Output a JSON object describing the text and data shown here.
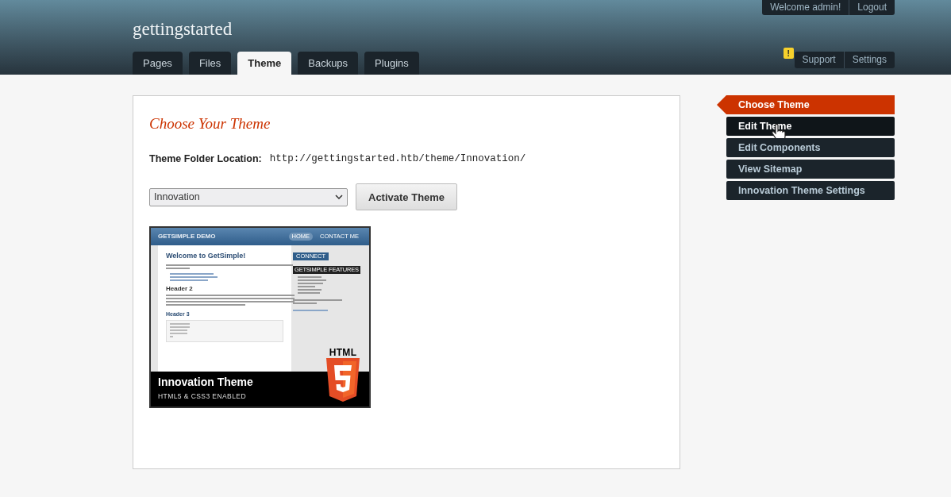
{
  "header": {
    "site_title": "gettingstarted",
    "user_links": [
      {
        "label": "Welcome admin!"
      },
      {
        "label": "Logout"
      }
    ],
    "tabs": [
      {
        "label": "Pages",
        "selected": false
      },
      {
        "label": "Files",
        "selected": false
      },
      {
        "label": "Theme",
        "selected": true
      },
      {
        "label": "Backups",
        "selected": false
      },
      {
        "label": "Plugins",
        "selected": false
      }
    ],
    "alert_badge": "!",
    "util_links": [
      {
        "label": "Support"
      },
      {
        "label": "Settings"
      }
    ]
  },
  "main": {
    "title": "Choose Your Theme",
    "folder_label": "Theme Folder Location:",
    "folder_url": "http://gettingstarted.htb/theme/Innovation/",
    "theme_select": "Innovation",
    "activate_button": "Activate Theme",
    "preview": {
      "site_name": "GETSIMPLE DEMO",
      "nav": [
        {
          "label": "HOME",
          "selected": true
        },
        {
          "label": "CONTACT ME",
          "selected": false
        }
      ],
      "heading": "Welcome to GetSimple!",
      "header2": "Header 2",
      "header3": "Header 3",
      "connect": "CONNECT",
      "features_title": "GETSIMPLE FEATURES",
      "caption_title": "Innovation Theme",
      "caption_sub": "HTML5 & CSS3 ENABLED",
      "logo_text": "HTML"
    }
  },
  "sidebar": {
    "items": [
      {
        "label": "Choose Theme",
        "selected": true,
        "hovered": false
      },
      {
        "label": "Edit Theme",
        "selected": false,
        "hovered": true
      },
      {
        "label": "Edit Components",
        "selected": false,
        "hovered": false
      },
      {
        "label": "View Sitemap",
        "selected": false,
        "hovered": false
      },
      {
        "label": "Innovation Theme Settings",
        "selected": false,
        "hovered": false
      }
    ]
  }
}
